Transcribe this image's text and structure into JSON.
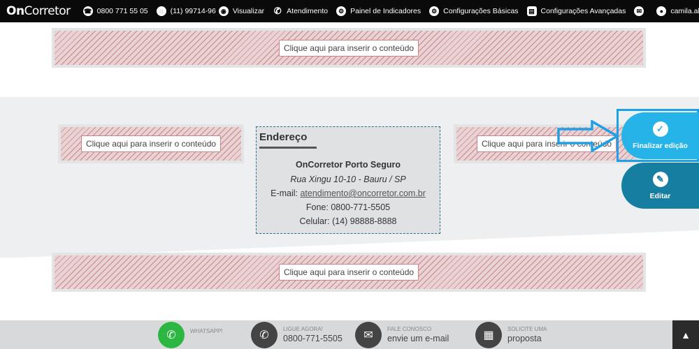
{
  "topbar": {
    "logo_bold": "On",
    "logo_rest": "Corretor",
    "phone": "0800 771 55 05",
    "whatsapp": "(11) 99714-96",
    "menu": [
      {
        "label": "Visualizar",
        "icon": "eye-icon",
        "glyph": "◉"
      },
      {
        "label": "Atendimento",
        "icon": "phone-icon",
        "glyph": "✆"
      },
      {
        "label": "Painel de Indicadores",
        "icon": "gear-icon",
        "glyph": "⚙"
      },
      {
        "label": "Configurações Básicas",
        "icon": "gear-icon",
        "glyph": "⚙"
      },
      {
        "label": "Configurações Avançadas",
        "icon": "settings-doc-icon",
        "glyph": "▤"
      }
    ],
    "user": "camila.alv..."
  },
  "placeholder_label": "Clique aqui para inserir o conteúdo",
  "address": {
    "title": "Endereço",
    "company": "OnCorretor Porto Seguro",
    "street": "Rua Xingu 10-10 - Bauru / SP",
    "email_label": "E-mail:",
    "email": "atendimento@oncorretor.com.br",
    "fone_label": "Fone:",
    "fone": "0800-771-5505",
    "celular_label": "Celular:",
    "celular": "(14) 98888-8888"
  },
  "actions": {
    "finalize": "Finalizar edição",
    "edit": "Editar"
  },
  "footer": {
    "whatsapp_small": "WHATSAPP!",
    "call_small": "LIGUE AGORA!",
    "call_big": "0800-771-5505",
    "mail_small": "FALE CONOSCO",
    "mail_big": "envie um e-mail",
    "quote_small": "SOLICITE UMA",
    "quote_big": "proposta"
  },
  "colors": {
    "accent_blue": "#26b4e8",
    "edit_blue": "#167ea0",
    "whatsapp_green": "#2cb742"
  }
}
